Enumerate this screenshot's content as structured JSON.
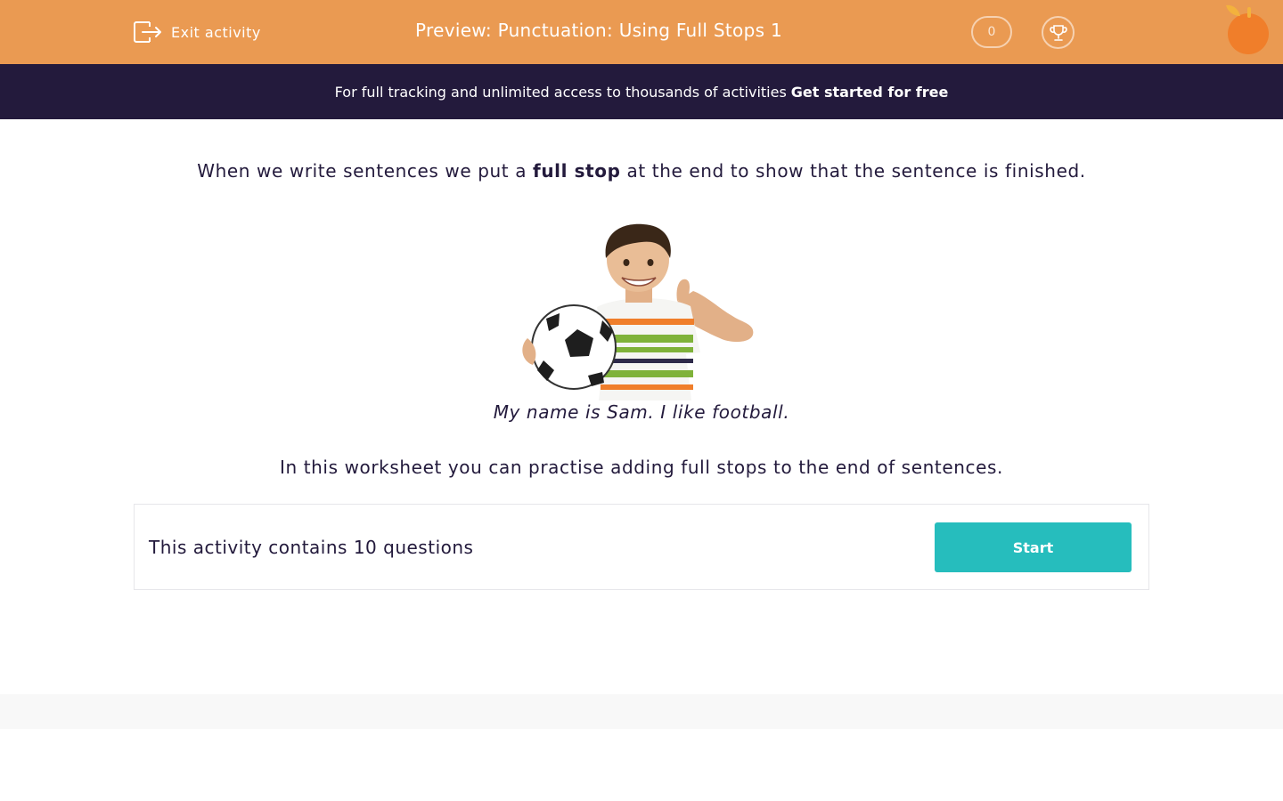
{
  "header": {
    "exit_label": "Exit activity",
    "title": "Preview: Punctuation: Using Full Stops 1",
    "score": "0",
    "icons": [
      "exit-icon",
      "trophy-icon",
      "orange-logo"
    ],
    "background_color": "#ea9a52"
  },
  "banner": {
    "text": "For full tracking and unlimited access to thousands of activities",
    "link": "Get started for free",
    "background_color": "#231a3c"
  },
  "content": {
    "intro_before": "When we write sentences we put a ",
    "intro_bold": "full stop",
    "intro_after": " at the end to show that the sentence is finished.",
    "caption": "My name is Sam. I like football.",
    "info": "In this worksheet you can practise adding full stops to the end of sentences."
  },
  "activity": {
    "text": "This activity contains 10 questions",
    "start_label": "Start",
    "start_color": "#26bdbd"
  }
}
